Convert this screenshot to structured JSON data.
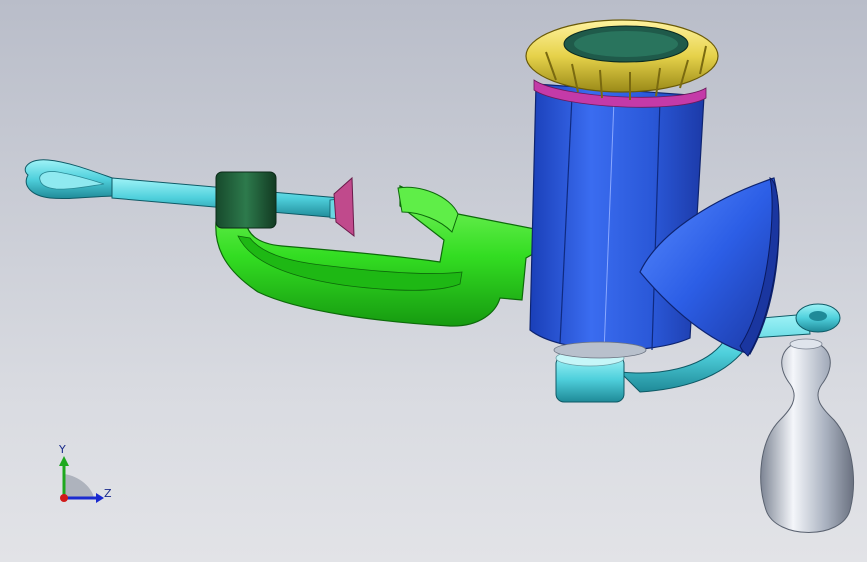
{
  "triad": {
    "y_label": "Y",
    "z_label": "Z"
  },
  "colors": {
    "background_top": "#b9bdc9",
    "background_bottom": "#e2e3e7",
    "cyan_parts": "#4fd0dc",
    "green_clamp": "#33dd22",
    "dark_green_collar": "#1f5a3a",
    "blue_body": "#2a5fe0",
    "gold_ring": "#e6d24a",
    "magenta_band": "#c43aa8",
    "silver_handle": "#c8d0dc",
    "cutter_disc": "#c04a8c"
  }
}
